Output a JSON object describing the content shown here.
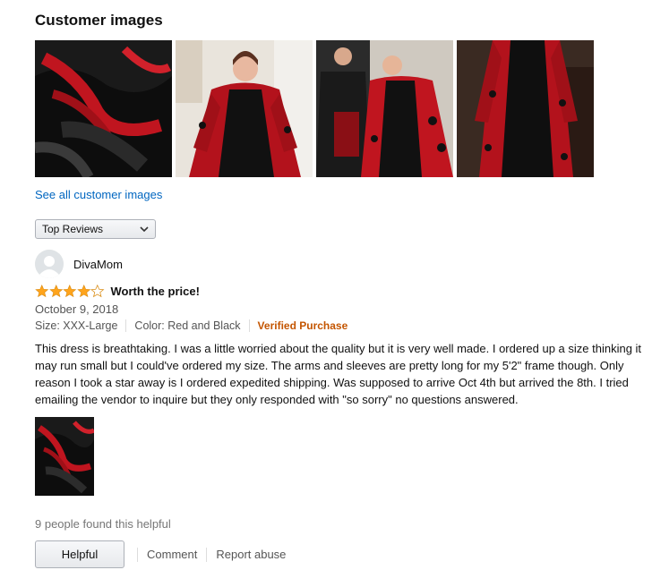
{
  "section": {
    "title": "Customer images"
  },
  "customer_images": [
    {
      "alt": "black and red dress with ruffles"
    },
    {
      "alt": "woman in red and black gown"
    },
    {
      "alt": "couple in gothic costume"
    },
    {
      "alt": "red and black gown on mannequin"
    }
  ],
  "see_all_label": "See all customer images",
  "sort": {
    "selected": "Top Reviews"
  },
  "review": {
    "reviewer_name": "DivaMom",
    "rating": 4,
    "rating_max": 5,
    "title": "Worth the price!",
    "date": "October 9, 2018",
    "size": "Size: XXX-Large",
    "color": "Color: Red and Black",
    "verified": "Verified Purchase",
    "body": "This dress is breathtaking. I was a little worried about the quality but it is very well made. I ordered up a size thinking it may run small but I could've ordered my size. The arms and sleeves are pretty long for my 5'2\" frame though. Only reason I took a star away is I ordered expedited shipping. Was supposed to arrive Oct 4th but arrived the 8th. I tried emailing the vendor to inquire but they only responded with \"so sorry\" no questions answered.",
    "helpful_count": "9 people found this helpful",
    "helpful_label": "Helpful",
    "comment_label": "Comment",
    "report_label": "Report abuse"
  },
  "colors": {
    "link": "#0066c0",
    "star": "#ffa41c",
    "verified": "#c45500",
    "dress_red": "#c0151f"
  }
}
